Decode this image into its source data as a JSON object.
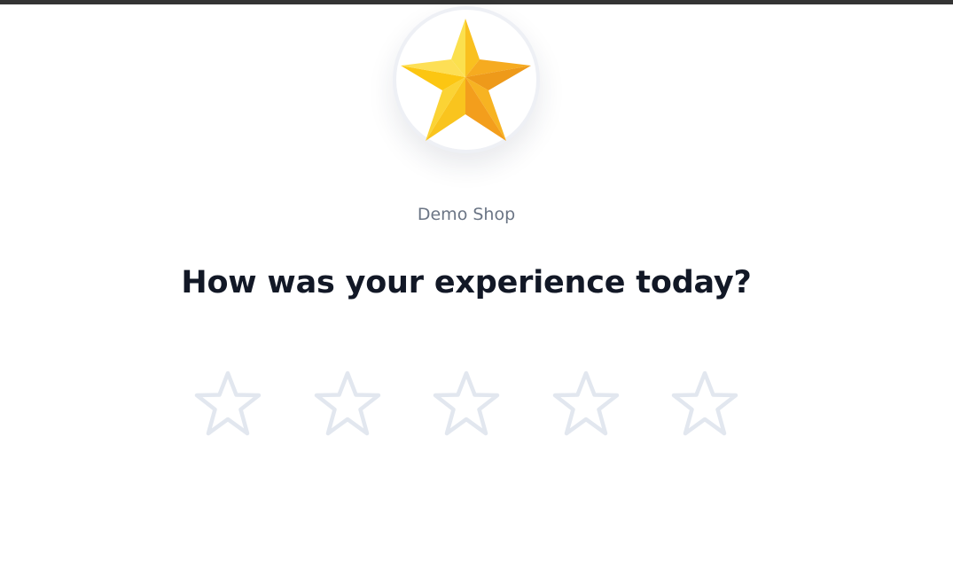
{
  "logo": {
    "icon": "star-icon",
    "colors": {
      "light": "#FBE04E",
      "mid": "#F9C41E",
      "dark": "#F3A11D",
      "deep": "#EE9A1A"
    }
  },
  "shop": {
    "name": "Demo Shop"
  },
  "survey": {
    "question": "How was your experience today?",
    "rating": {
      "selected": 0,
      "max": 5,
      "star_outline_color": "#E2E7EF"
    }
  }
}
